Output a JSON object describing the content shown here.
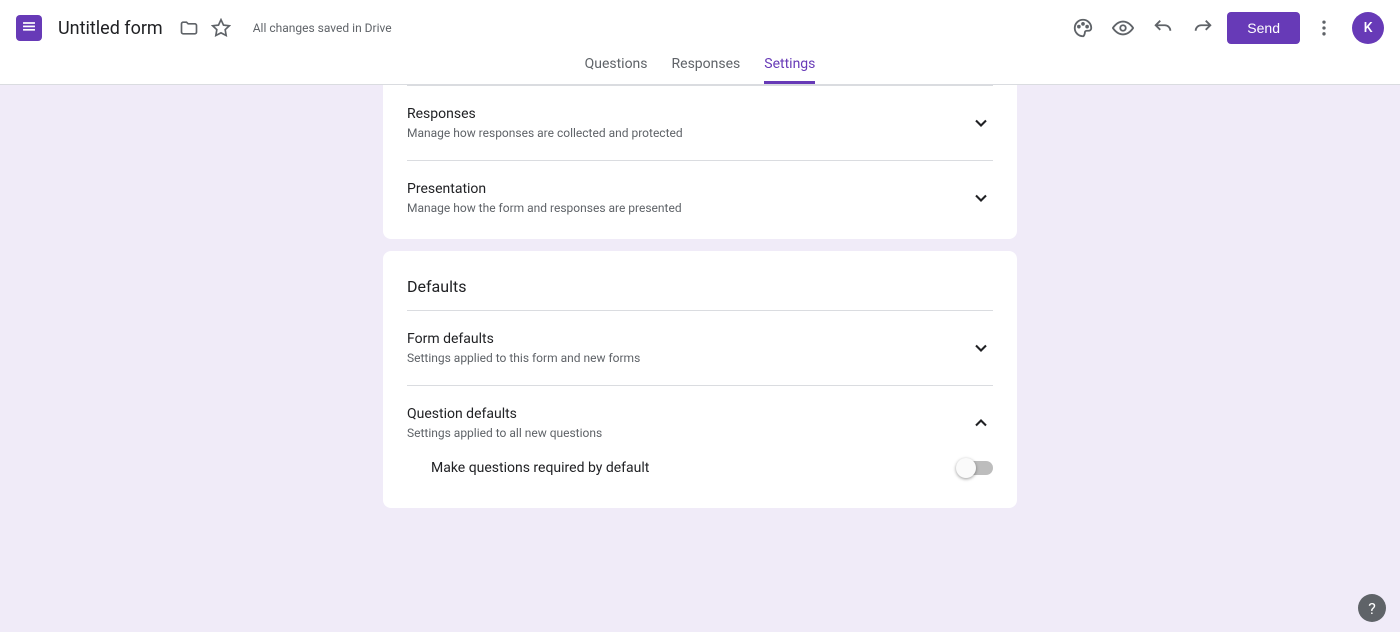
{
  "header": {
    "form_title": "Untitled form",
    "save_status": "All changes saved in Drive",
    "send_label": "Send",
    "avatar_initial": "K"
  },
  "tabs": {
    "questions": "Questions",
    "responses": "Responses",
    "settings": "Settings"
  },
  "settings_card": {
    "responses_title": "Responses",
    "responses_desc": "Manage how responses are collected and protected",
    "presentation_title": "Presentation",
    "presentation_desc": "Manage how the form and responses are presented"
  },
  "defaults_card": {
    "title": "Defaults",
    "form_defaults_title": "Form defaults",
    "form_defaults_desc": "Settings applied to this form and new forms",
    "question_defaults_title": "Question defaults",
    "question_defaults_desc": "Settings applied to all new questions",
    "required_toggle_label": "Make questions required by default"
  },
  "help": "?"
}
